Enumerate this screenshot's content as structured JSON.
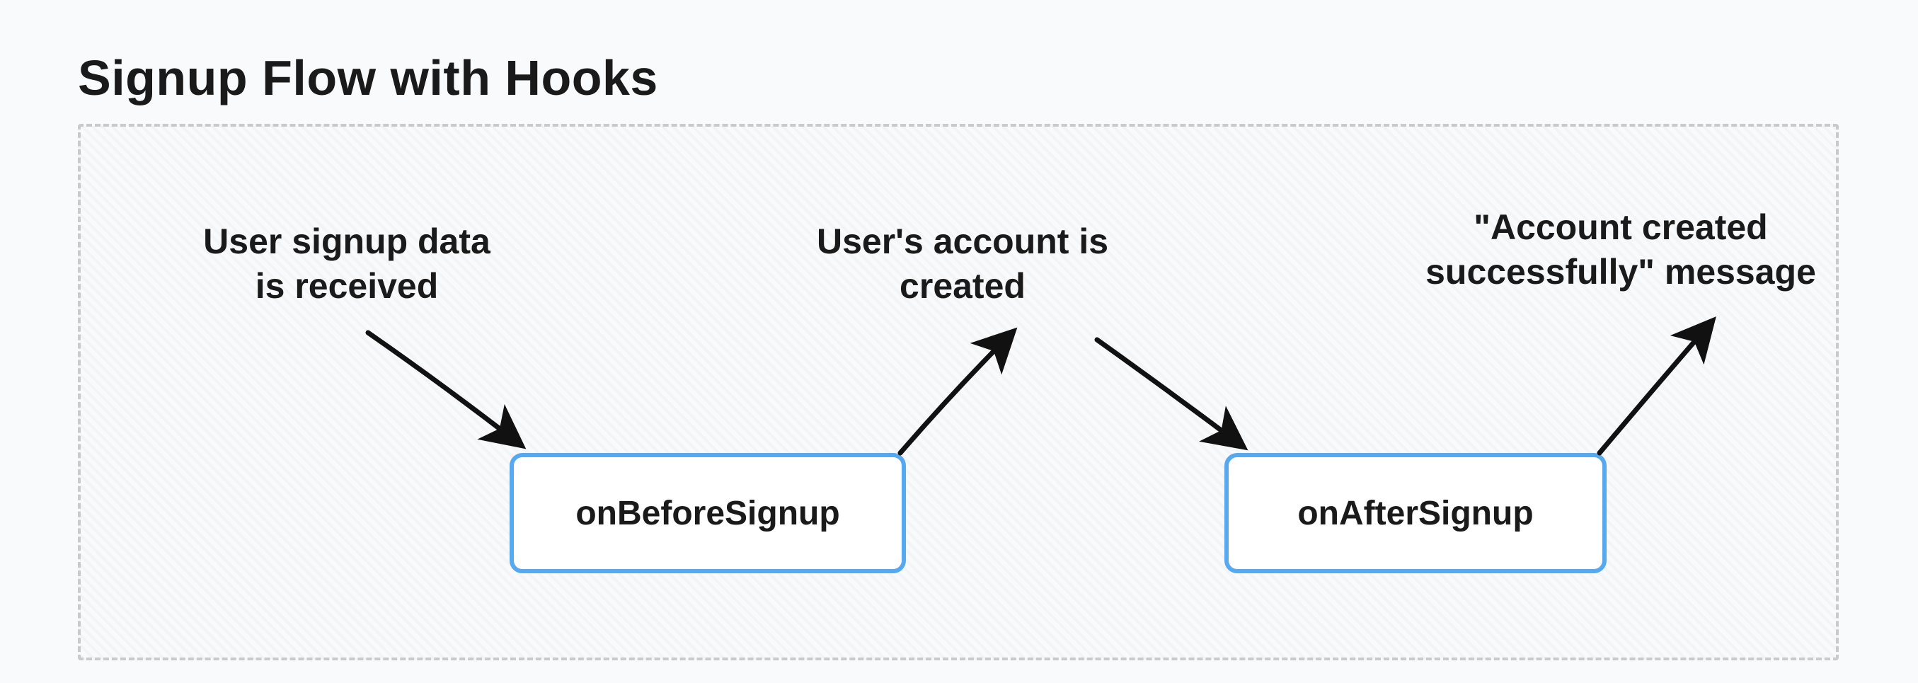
{
  "title": "Signup Flow with Hooks",
  "labels": {
    "input": "User signup data\nis received",
    "middle": "User's account is\ncreated",
    "output": "\"Account created\nsuccessfully\" message"
  },
  "nodes": {
    "before": "onBeforeSignup",
    "after": "onAfterSignup"
  }
}
